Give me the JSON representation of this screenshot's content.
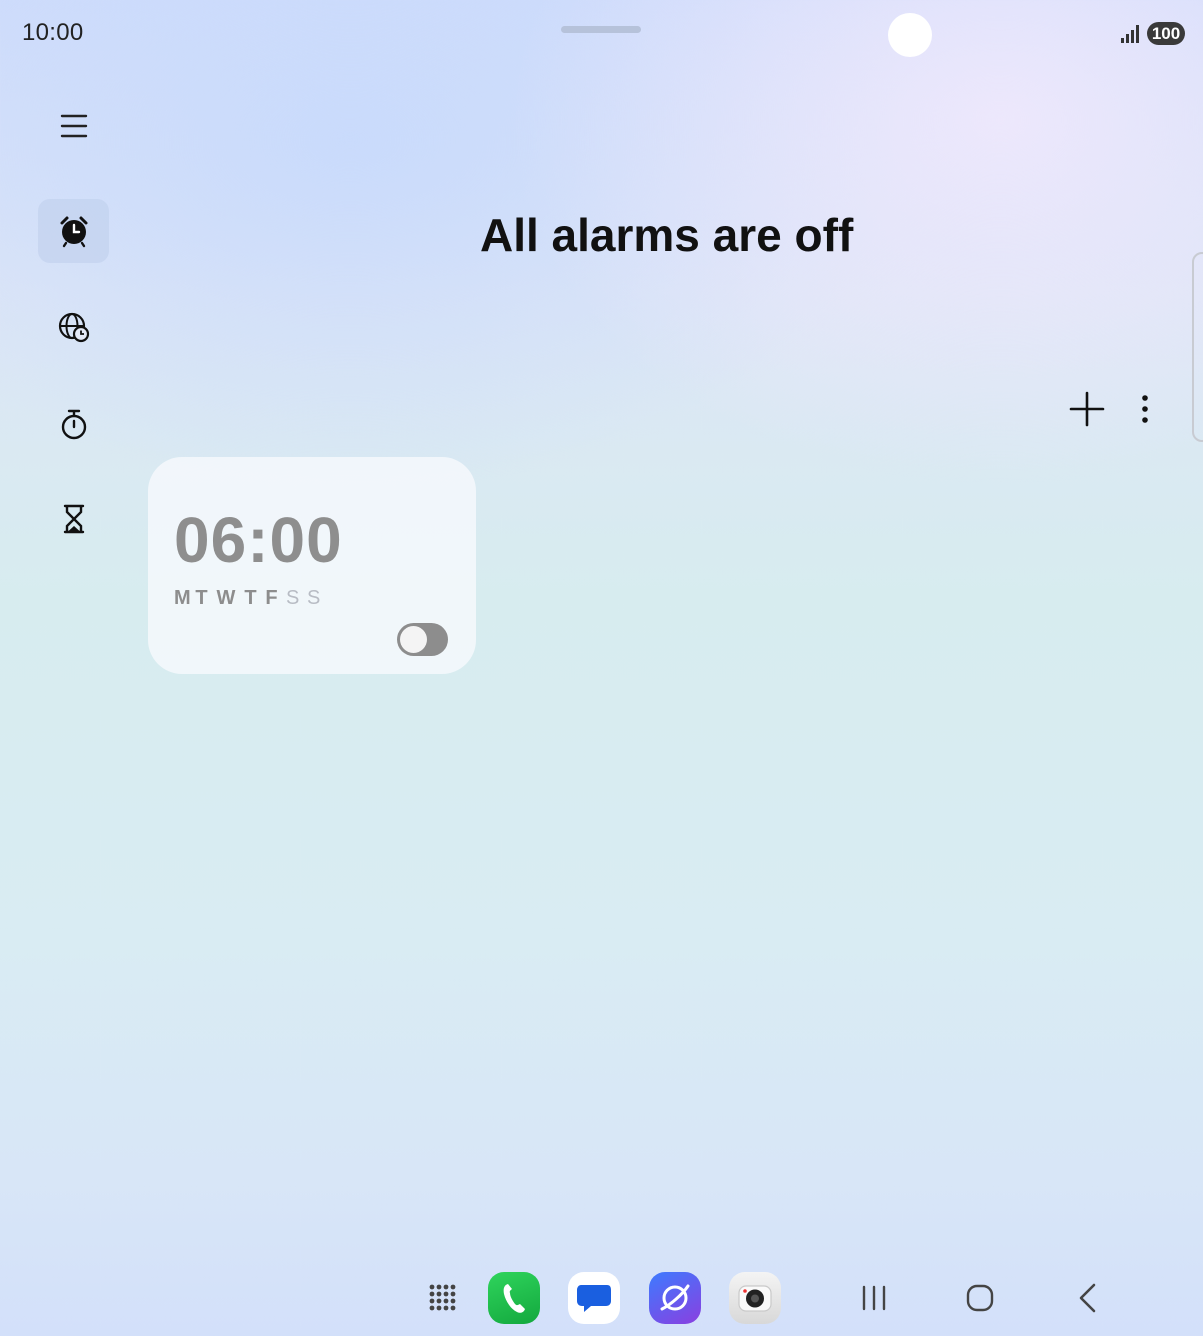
{
  "status_bar": {
    "time": "10:00",
    "battery": "100"
  },
  "nav_rail": {
    "items": [
      {
        "name": "alarm",
        "icon": "alarm-clock-icon",
        "active": true
      },
      {
        "name": "world-clock",
        "icon": "globe-clock-icon",
        "active": false
      },
      {
        "name": "stopwatch",
        "icon": "stopwatch-icon",
        "active": false
      },
      {
        "name": "timer",
        "icon": "hourglass-icon",
        "active": false
      }
    ]
  },
  "main": {
    "title": "All alarms are off"
  },
  "alarms": [
    {
      "time": "06:00",
      "days": [
        "M",
        "T",
        "W",
        "T",
        "F",
        "S",
        "S"
      ],
      "enabled": false
    }
  ],
  "dock": {
    "apps": [
      "app-drawer-icon",
      "phone-icon",
      "messages-icon",
      "browser-icon",
      "camera-icon"
    ]
  },
  "navigation": [
    "recents-icon",
    "home-icon",
    "back-icon"
  ],
  "colors": {
    "phone": "#1dbf4a",
    "messages_bubble": "#1a5fe0",
    "browser": "#6a4fe8",
    "toggle_off": "#8d8d8d"
  }
}
